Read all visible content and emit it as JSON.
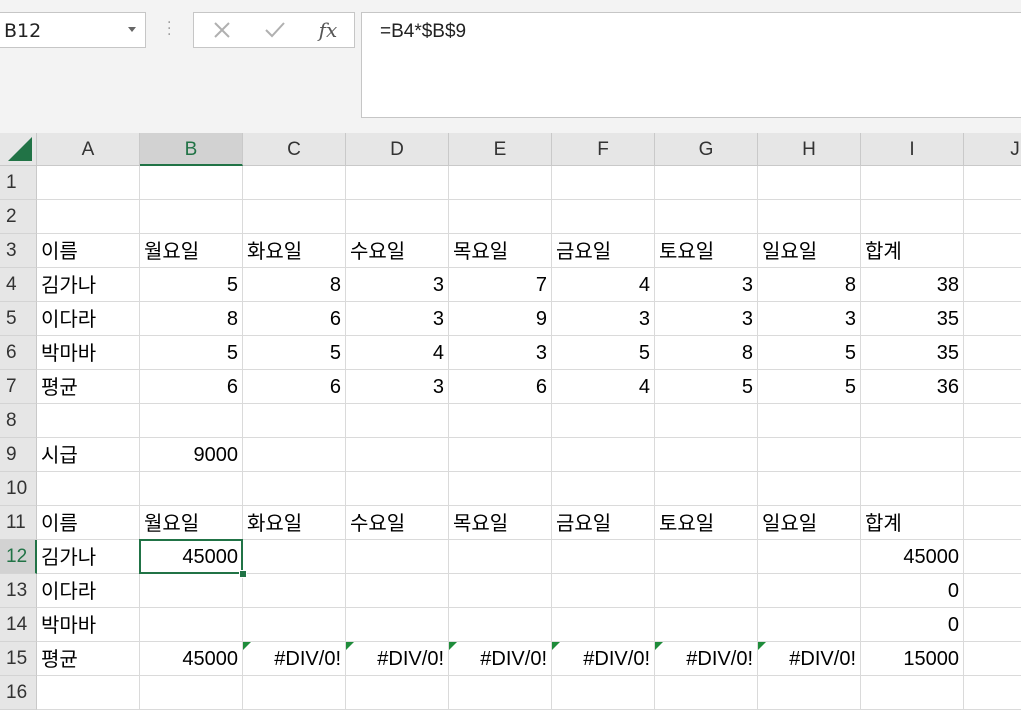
{
  "name_box": {
    "value": "B12"
  },
  "formula_bar": {
    "formula": "=B4*$B$9",
    "cancel_icon": "close-icon",
    "enter_icon": "check-icon",
    "insert_function_label": "fx"
  },
  "sheet": {
    "selected_column": "B",
    "selected_row": "12",
    "columns": [
      "A",
      "B",
      "C",
      "D",
      "E",
      "F",
      "G",
      "H",
      "I",
      "J"
    ],
    "rows": [
      "1",
      "2",
      "3",
      "4",
      "5",
      "6",
      "7",
      "8",
      "9",
      "10",
      "11",
      "12",
      "13",
      "14",
      "15",
      "16"
    ],
    "cells": {
      "A3": "이름",
      "B3": "월요일",
      "C3": "화요일",
      "D3": "수요일",
      "E3": "목요일",
      "F3": "금요일",
      "G3": "토요일",
      "H3": "일요일",
      "I3": "합계",
      "A4": "김가나",
      "B4": "5",
      "C4": "8",
      "D4": "3",
      "E4": "7",
      "F4": "4",
      "G4": "3",
      "H4": "8",
      "I4": "38",
      "A5": "이다라",
      "B5": "8",
      "C5": "6",
      "D5": "3",
      "E5": "9",
      "F5": "3",
      "G5": "3",
      "H5": "3",
      "I5": "35",
      "A6": "박마바",
      "B6": "5",
      "C6": "5",
      "D6": "4",
      "E6": "3",
      "F6": "5",
      "G6": "8",
      "H6": "5",
      "I6": "35",
      "A7": "평균",
      "B7": "6",
      "C7": "6",
      "D7": "3",
      "E7": "6",
      "F7": "4",
      "G7": "5",
      "H7": "5",
      "I7": "36",
      "A9": "시급",
      "B9": "9000",
      "A11": "이름",
      "B11": "월요일",
      "C11": "화요일",
      "D11": "수요일",
      "E11": "목요일",
      "F11": "금요일",
      "G11": "토요일",
      "H11": "일요일",
      "I11": "합계",
      "A12": "김가나",
      "B12": "45000",
      "I12": "45000",
      "A13": "이다라",
      "I13": "0",
      "A14": "박마바",
      "I14": "0",
      "A15": "평균",
      "B15": "45000",
      "C15": "#DIV/0!",
      "D15": "#DIV/0!",
      "E15": "#DIV/0!",
      "F15": "#DIV/0!",
      "G15": "#DIV/0!",
      "H15": "#DIV/0!",
      "I15": "15000"
    },
    "accent_color": "#217346",
    "error_indicator_color": "#1e8c3a"
  }
}
